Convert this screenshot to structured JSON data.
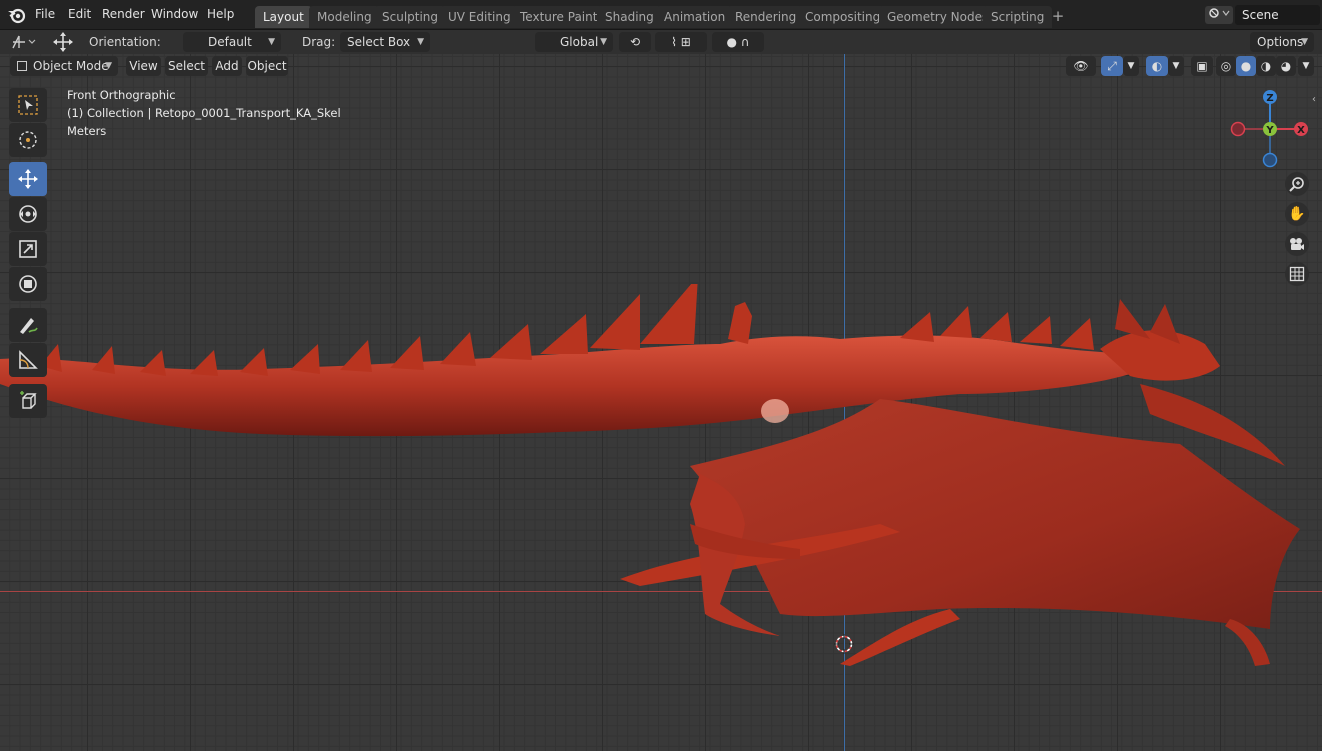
{
  "menu": {
    "items": [
      "File",
      "Edit",
      "Render",
      "Window",
      "Help"
    ]
  },
  "workspaces": [
    {
      "label": "Layout",
      "active": true
    },
    {
      "label": "Modeling",
      "active": false
    },
    {
      "label": "Sculpting",
      "active": false
    },
    {
      "label": "UV Editing",
      "active": false
    },
    {
      "label": "Texture Paint",
      "active": false
    },
    {
      "label": "Shading",
      "active": false
    },
    {
      "label": "Animation",
      "active": false
    },
    {
      "label": "Rendering",
      "active": false
    },
    {
      "label": "Compositing",
      "active": false
    },
    {
      "label": "Geometry Nodes",
      "active": false
    },
    {
      "label": "Scripting",
      "active": false
    }
  ],
  "scene": {
    "name": "Scene"
  },
  "tool_header": {
    "orientation_label": "Orientation:",
    "orientation_value": "Default",
    "drag_label": "Drag:",
    "drag_value": "Select Box",
    "transform_orientation": "Global",
    "options_label": "Options"
  },
  "viewport_header": {
    "mode": "Object Mode",
    "menus": [
      "View",
      "Select",
      "Add",
      "Object"
    ]
  },
  "overlay": {
    "view_name": "Front Orthographic",
    "collection": "(1) Collection | Retopo_0001_Transport_KA_Skel",
    "units": "Meters"
  },
  "gizmo": {
    "axes": [
      "Z",
      "Y",
      "X"
    ]
  },
  "colors": {
    "accent": "#4772b3",
    "dragon": "#b23423",
    "x_axis": "#d9414f",
    "y_axis": "#8ac23c",
    "z_axis": "#3a85d6"
  }
}
